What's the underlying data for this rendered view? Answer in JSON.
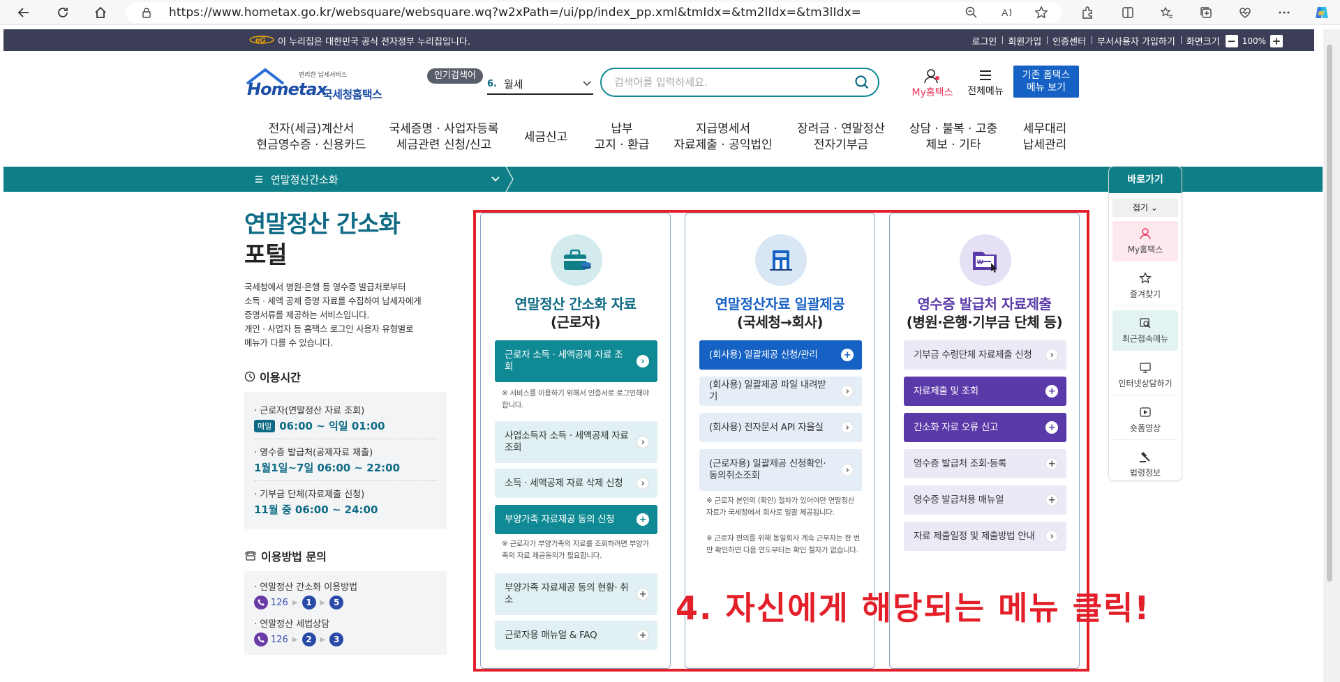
{
  "browser": {
    "url": "https://www.hometax.go.kr/websquare/websquare.wq?w2xPath=/ui/pp/index_pp.xml&tmIdx=&tm2lIdx=&tm3lIdx="
  },
  "notice": {
    "gov_text": "이 누리집은 대한민국 공식 전자정부 누리집입니다.",
    "util_menu": [
      "로그인",
      "회원가입",
      "인증센터",
      "부서사용자 가입하기",
      "화면크기"
    ],
    "zoom": "100%",
    "zoom_minus": "−",
    "zoom_plus": "+"
  },
  "header": {
    "logo_small": "편리한 납세서비스",
    "logo_main": "Hometax",
    "logo_sub": "국세청홈택스",
    "popular_tag": "인기검색어",
    "popular_rank": "6.",
    "popular_word": "월세",
    "search_placeholder": "검색어를 입력하세요.",
    "myhometax": "My홈택스",
    "allmenu": "전체메뉴",
    "old_btn_line1": "기존 홈택스",
    "old_btn_line2": "메뉴 보기"
  },
  "gnb": [
    {
      "l1": "전자(세금)계산서",
      "l2": "현금영수증 · 신용카드"
    },
    {
      "l1": "국세증명 · 사업자등록",
      "l2": "세금관련 신청/신고"
    },
    {
      "l1": "세금신고",
      "l2": ""
    },
    {
      "l1": "납부",
      "l2": "고지 · 환급"
    },
    {
      "l1": "지급명세서",
      "l2": "자료제출 · 공익법인"
    },
    {
      "l1": "장려금 · 연말정산",
      "l2": "전자기부금"
    },
    {
      "l1": "상담 · 불복 · 고충",
      "l2": "제보 · 기타"
    },
    {
      "l1": "세무대리",
      "l2": "납세관리"
    }
  ],
  "submenu": {
    "label": "연말정산간소화"
  },
  "left": {
    "title_1": "연말정산 간소화",
    "title_2": "포털",
    "desc_1": "국세청에서 병원·은행 등 영수증 발급처로부터",
    "desc_2": "소득 · 세액 공제 증명 자료를 수집하여 납세자에게",
    "desc_3": "증명서류를 제공하는 서비스입니다.",
    "desc_4": "개인 · 사업자 등 홈택스 로그인 사용자 유형별로",
    "desc_5": "메뉴가 다를 수 있습니다.",
    "hours_head": "이용시간",
    "hours": [
      {
        "label": "· 근로자(연말정산 자료 조회)",
        "badge": "매일",
        "time": "06:00 ~ 익일 01:00"
      },
      {
        "label": "· 영수증 발급처(공제자료 제출)",
        "badge": "",
        "time": "1월1일~7일 06:00 ~ 22:00"
      },
      {
        "label": "· 기부금 단체(자료제출 신청)",
        "badge": "",
        "time": "11월 중 06:00 ~ 24:00"
      }
    ],
    "inquiry_head": "이용방법 문의",
    "inquiry": [
      {
        "label": "· 연말정산 간소화 이용방법",
        "phone": "126",
        "n1": "1",
        "n2": "5"
      },
      {
        "label": "· 연말정산 세법상담",
        "phone": "126",
        "n1": "2",
        "n2": "3"
      }
    ]
  },
  "cards": [
    {
      "title_1": "연말정산 간소화 자료",
      "title_2": "(근로자)",
      "color": "#0f6b85",
      "buttons": [
        {
          "label": "근로자 소득 · 세액공제 자료 조회",
          "icon": "arrow-right-icon"
        },
        {
          "label": "사업소득자 소득 · 세액공제 자료 조회",
          "icon": "arrow-right-icon"
        },
        {
          "label": "소득 · 세액공제 자료 삭제 신청",
          "icon": "arrow-right-icon"
        },
        {
          "label": "부양가족 자료제공 동의 신청",
          "icon": "plus-icon"
        },
        {
          "label": "부양가족 자료제공 동의 현황· 취소",
          "icon": "plus-icon"
        },
        {
          "label": "근로자용 매뉴얼 & FAQ",
          "icon": "plus-icon"
        }
      ],
      "note_1": "※ 서비스를 이용하기 위해서 인증서로 로그인해야 합니다.",
      "note_2": "※ 근로자가 부양가족의 자료를 조회하려면 부양가족의 자료 제공동의가 필요합니다."
    },
    {
      "title_1": "연말정산자료 일괄제공",
      "title_2": "(국세청→회사)",
      "color": "#1661c4",
      "buttons": [
        {
          "label": "(회사용) 일괄제공 신청/관리",
          "icon": "plus-icon"
        },
        {
          "label": "(회사용) 일괄제공 파일 내려받기",
          "icon": "arrow-right-icon"
        },
        {
          "label": "(회사용) 전자문서 API 자율실",
          "icon": "arrow-right-icon"
        },
        {
          "label": "(근로자용) 일괄제공 신청확인· 동의취소조회",
          "icon": "arrow-right-icon"
        }
      ],
      "note_1": "※ 근로자 본인의 (확인) 절차가 있어야만 연말정산 자료가 국세청에서 회사로 일괄 제공됩니다.",
      "note_2": "※ 근로자 편의를 위해 동일회사 계속 근무자는 한 번만 확인하면 다음 연도부터는 확인 절차가 없습니다."
    },
    {
      "title_1": "영수증 발급처 자료제출",
      "title_2": "(병원·은행·기부금 단체 등)",
      "color": "#5a3aa8",
      "buttons": [
        {
          "label": "기부금 수령단체 자료제출 신청",
          "icon": "arrow-right-icon"
        },
        {
          "label": "자료제출 및 조회",
          "icon": "plus-icon"
        },
        {
          "label": "간소화 자료 오류 신고",
          "icon": "plus-icon"
        },
        {
          "label": "영수증 발급처 조회·등록",
          "icon": "plus-icon"
        },
        {
          "label": "영수증 발급처용 매뉴얼",
          "icon": "plus-icon"
        },
        {
          "label": "자료 제출일정 및 제출방법 안내",
          "icon": "arrow-right-icon"
        }
      ]
    }
  ],
  "overlay_text": "4. 자신에게 해당되는 메뉴 클릭!",
  "quick": {
    "head": "바로가기",
    "fold": "접기",
    "items": [
      "My홈택스",
      "즐겨찾기",
      "최근접속메뉴",
      "인터넷상담하기",
      "숏폼영상",
      "법령정보"
    ]
  },
  "colors": {
    "teal": "#0f7f87",
    "blue": "#1661c4",
    "purple": "#5a3aa8",
    "red": "#e3202a",
    "navy": "#3c3e57"
  }
}
